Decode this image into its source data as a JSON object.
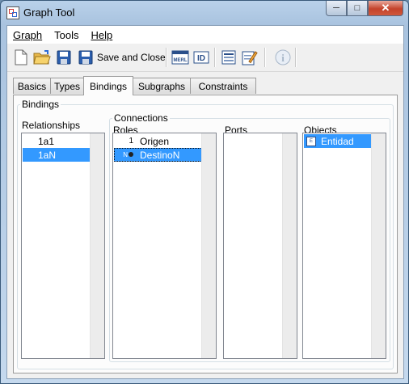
{
  "window": {
    "title": "Graph Tool",
    "min_glyph": "─",
    "max_glyph": "□",
    "close_glyph": "✕"
  },
  "menu": {
    "graph": "Graph",
    "tools": "Tools",
    "help": "Help"
  },
  "toolbar": {
    "save_close_label": "Save and Close",
    "merl_label": "MERL",
    "id_label": "ID",
    "info_label": "i"
  },
  "tabs": {
    "basics": "Basics",
    "types": "Types",
    "bindings": "Bindings",
    "subgraphs": "Subgraphs",
    "constraints": "Constraints"
  },
  "bindings": {
    "group_title": "Bindings",
    "relationships_header": "Relationships",
    "relationships": [
      "1a1",
      "1aN"
    ],
    "connections_title": "Connections",
    "roles_header": "Roles",
    "roles": [
      {
        "card": "1",
        "name": "Origen"
      },
      {
        "card": "N",
        "name": "DestinoN"
      }
    ],
    "ports_header": "Ports",
    "objects_header": "Objects",
    "objects": [
      {
        "icon_text": "E",
        "name": "Entidad"
      }
    ]
  }
}
